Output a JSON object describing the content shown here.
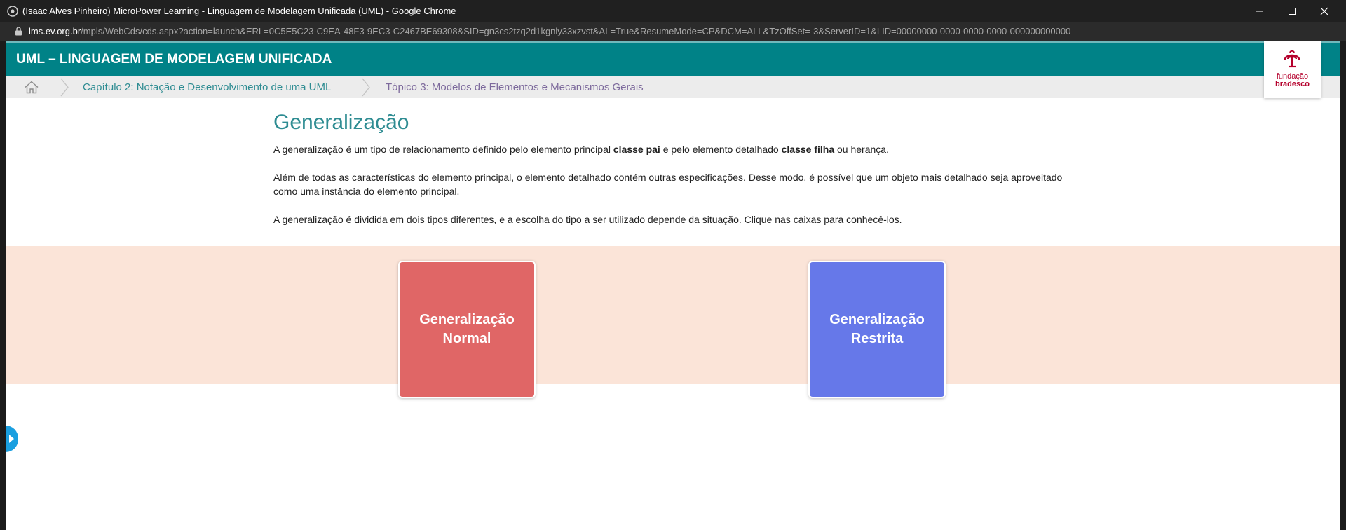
{
  "window": {
    "title": "(Isaac Alves Pinheiro) MicroPower Learning - Linguagem de Modelagem Unificada (UML) - Google Chrome",
    "url_host": "lms.ev.org.br",
    "url_path": "/mpls/WebCds/cds.aspx?action=launch&ERL=0C5E5C23-C9EA-48F3-9EC3-C2467BE69308&SID=gn3cs2tzq2d1kgnly33xzvst&AL=True&ResumeMode=CP&DCM=ALL&TzOffSet=-3&ServerID=1&LID=00000000-0000-0000-0000-000000000000"
  },
  "header": {
    "title": "UML – LINGUAGEM DE MODELAGEM UNIFICADA",
    "logo_line1": "fundação",
    "logo_line2": "bradesco"
  },
  "breadcrumb": {
    "items": [
      {
        "label": "Capítulo 2: Notação e Desenvolvimento de uma UML",
        "color": "#2e8c92"
      },
      {
        "label": "Tópico 3: Modelos de Elementos e Mecanismos Gerais",
        "color": "#7d6a9c"
      }
    ]
  },
  "main": {
    "heading": "Generalização",
    "p1_a": "A generalização é um tipo de relacionamento definido pelo elemento principal ",
    "p1_b": "classe pai",
    "p1_c": " e pelo elemento detalhado ",
    "p1_d": "classe filha",
    "p1_e": " ou herança.",
    "p2": "Além de todas as características do elemento principal, o elemento detalhado contém outras especificações. Desse modo, é possível que um objeto mais detalhado seja aproveitado como uma instância do elemento principal.",
    "p3": "A generalização é dividida em dois tipos diferentes, e a escolha do tipo a ser utilizado depende da situação. Clique nas caixas para conhecê-los."
  },
  "cards": [
    {
      "line1": "Generalização",
      "line2": "Normal",
      "color": "#e06666"
    },
    {
      "line1": "Generalização",
      "line2": "Restrita",
      "color": "#6678e9"
    }
  ],
  "colors": {
    "header_bg": "#008287",
    "band_bg": "#fbe4d8",
    "accent": "#2e8c92"
  }
}
